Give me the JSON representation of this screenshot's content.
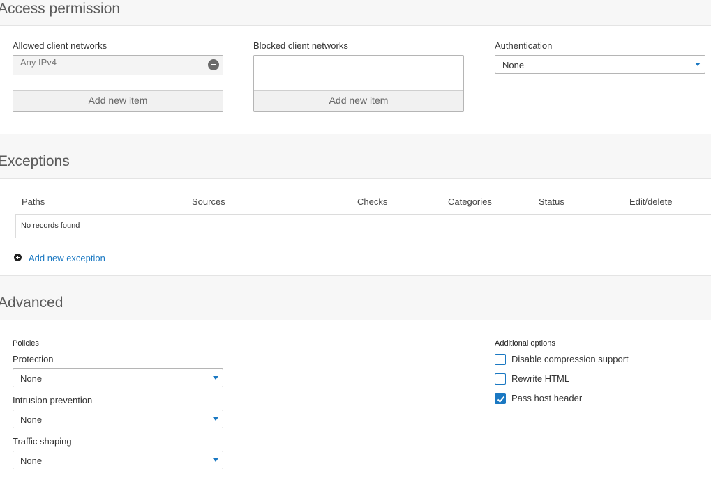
{
  "access_permission": {
    "title": "Access permission",
    "allowed": {
      "label": "Allowed client networks",
      "items": [
        "Any IPv4"
      ],
      "add_label": "Add new item"
    },
    "blocked": {
      "label": "Blocked client networks",
      "add_label": "Add new item"
    },
    "authentication": {
      "label": "Authentication",
      "value": "None"
    }
  },
  "exceptions": {
    "title": "Exceptions",
    "columns": [
      "Paths",
      "Sources",
      "Checks",
      "Categories",
      "Status",
      "Edit/delete"
    ],
    "empty_text": "No records found",
    "add_label": "Add new exception"
  },
  "advanced": {
    "title": "Advanced",
    "policies": {
      "heading": "Policies",
      "protection": {
        "label": "Protection",
        "value": "None"
      },
      "intrusion_prevention": {
        "label": "Intrusion prevention",
        "value": "None"
      },
      "traffic_shaping": {
        "label": "Traffic shaping",
        "value": "None"
      }
    },
    "additional_options": {
      "heading": "Additional options",
      "options": [
        {
          "label": "Disable compression support",
          "checked": false
        },
        {
          "label": "Rewrite HTML",
          "checked": false
        },
        {
          "label": "Pass host header",
          "checked": true
        }
      ]
    }
  },
  "colors": {
    "accent": "#1a78c2",
    "section_bg": "#f7f7f7"
  }
}
